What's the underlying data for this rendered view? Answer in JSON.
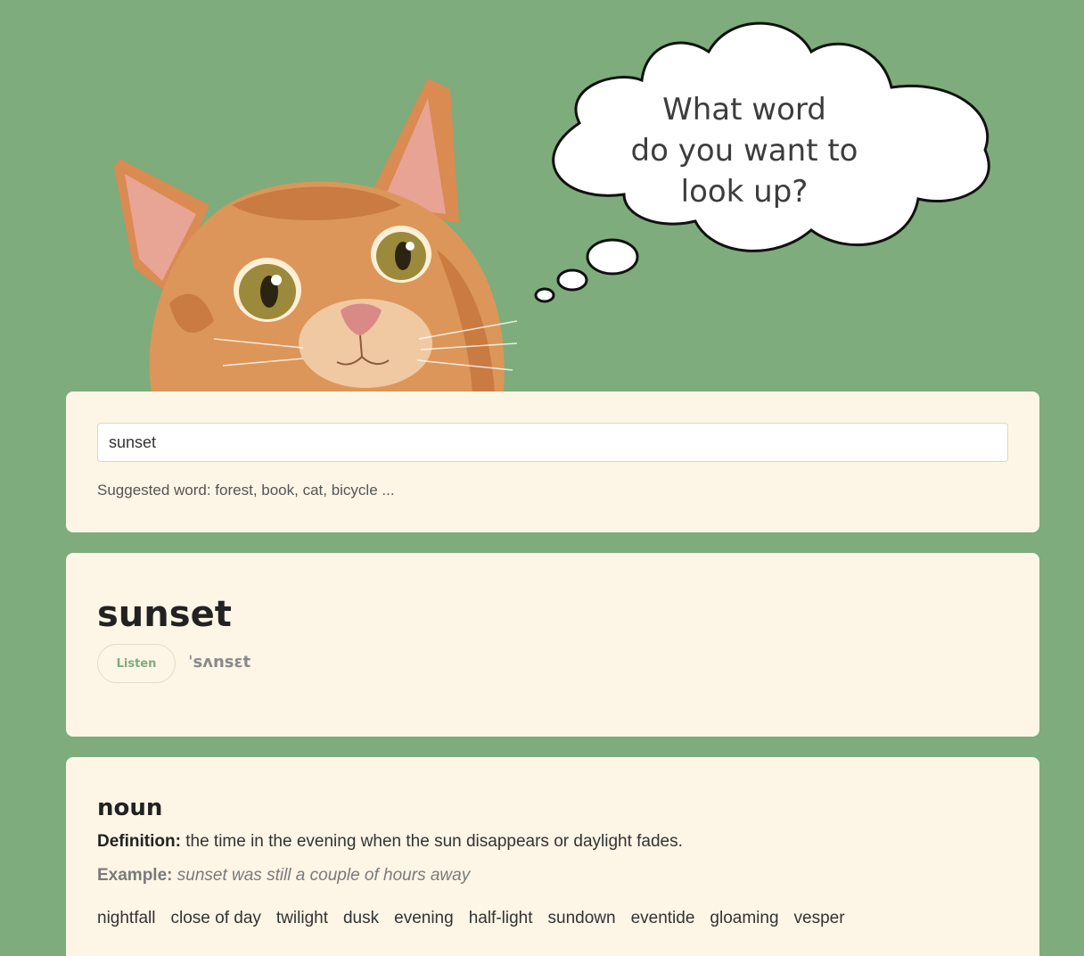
{
  "thought": {
    "lines": [
      "What word",
      "do you want to",
      "look up?"
    ]
  },
  "search": {
    "value": "sunset",
    "placeholder": "",
    "suggestion": "Suggested word: forest, book, cat, bicycle ..."
  },
  "word": {
    "title": "sunset",
    "listen_label": "Listen",
    "phonetic": "ˈsʌnsɛt"
  },
  "meaning": {
    "part_of_speech": "noun",
    "definition_label": "Definition:",
    "definition": "the time in the evening when the sun disappears or daylight fades.",
    "example_label": "Example:",
    "example": "sunset was still a couple of hours away",
    "synonyms": [
      "nightfall",
      "close of day",
      "twilight",
      "dusk",
      "evening",
      "half-light",
      "sundown",
      "eventide",
      "gloaming",
      "vesper"
    ]
  },
  "colors": {
    "background": "#7eac7c",
    "card": "#fdf5e6",
    "accent": "#7eac7c"
  }
}
